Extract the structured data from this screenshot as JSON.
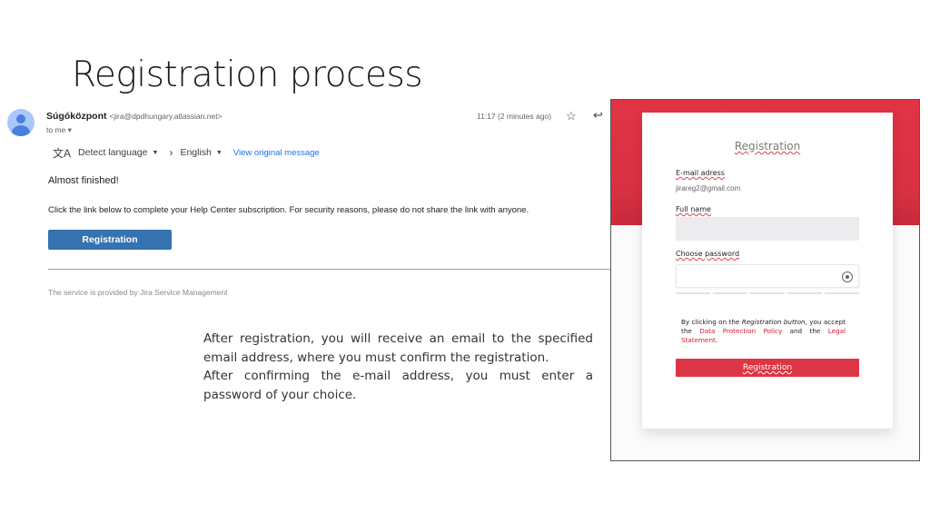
{
  "slide": {
    "title": "Registration process"
  },
  "email": {
    "sender_name": "Súgóközpont",
    "sender_address": "<jira@dpdhungary.atlassian.net>",
    "recipient": "to me ▾",
    "time": "11:17 (2 minutes ago)",
    "icons": {
      "avatar": "person-icon",
      "star": "star-icon",
      "reply": "reply-icon",
      "translate": "translate-icon"
    },
    "translate": {
      "source": "Detect language",
      "target": "English",
      "view_original": "View original message"
    },
    "greeting": "Almost finished!",
    "body": "Click the link below to complete your Help Center subscription. For security reasons, please do not share the link with anyone.",
    "button_label": "Registration",
    "button_color": "#3572b0",
    "footer": "The service is provided by Jira Service Management"
  },
  "description": {
    "paragraphs": [
      "After registration, you will receive an email to the specified email address, where you must confirm the registration.",
      "After confirming the e-mail address, you must enter a password of your choice."
    ]
  },
  "registration_form": {
    "title": "Registration",
    "email_label": "E-mail adress",
    "email_value": "jirareg2@gmail.com",
    "fullname_label": "Full name",
    "fullname_value": "",
    "password_label": "Choose password",
    "password_value": "",
    "consent_prefix": "By clicking on the ",
    "consent_button_ref": "Registration button",
    "consent_mid": ", you accept the ",
    "consent_link1": "Data Protection Policy",
    "consent_and": " and the ",
    "consent_link2": "Legal Statement",
    "consent_end": ".",
    "submit_label": "Registration",
    "accent_color": "#dc3545"
  }
}
